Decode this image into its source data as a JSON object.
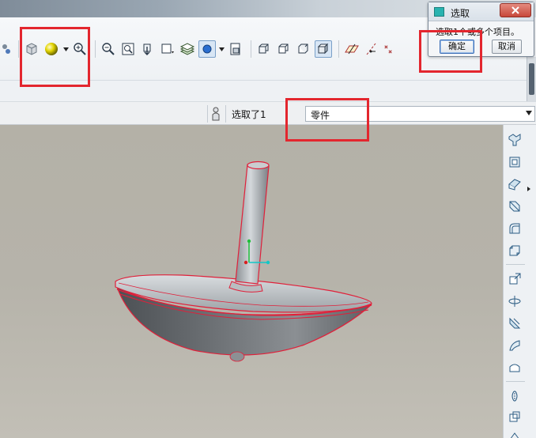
{
  "dialog": {
    "title": "选取",
    "message": "选取1个或多个项目。",
    "ok_label": "确定",
    "cancel_label": "取消",
    "close_icon": "x-icon"
  },
  "selection_bar": {
    "status": "选取了1",
    "filter_value": "零件"
  },
  "toolbar": {
    "icons": [
      "regen-icon",
      "saved-view-icon",
      "shading-sphere-icon",
      "zoom-in-icon",
      "zoom-out-icon",
      "refit-icon",
      "reorient-icon",
      "view-list-icon",
      "layers-icon",
      "display-style-icon",
      "spin-center-icon",
      "wireframe-icon",
      "hidden-line-icon",
      "no-hidden-icon",
      "shaded-icon",
      "datum-plane-icon",
      "datum-axis-icon",
      "datum-point-icon"
    ],
    "accent_color": "#7aa0c8"
  },
  "right_toolbar": {
    "icons": [
      "extrude-icon",
      "revolve-icon",
      "sweep-icon",
      "blend-icon",
      "round-icon",
      "chamfer-icon",
      "hole-icon",
      "pattern-icon",
      "mirror-icon",
      "draft-icon",
      "shell-icon",
      "rib-icon",
      "merge-icon",
      "trim-icon"
    ]
  },
  "annotation_color": "#e3262e"
}
